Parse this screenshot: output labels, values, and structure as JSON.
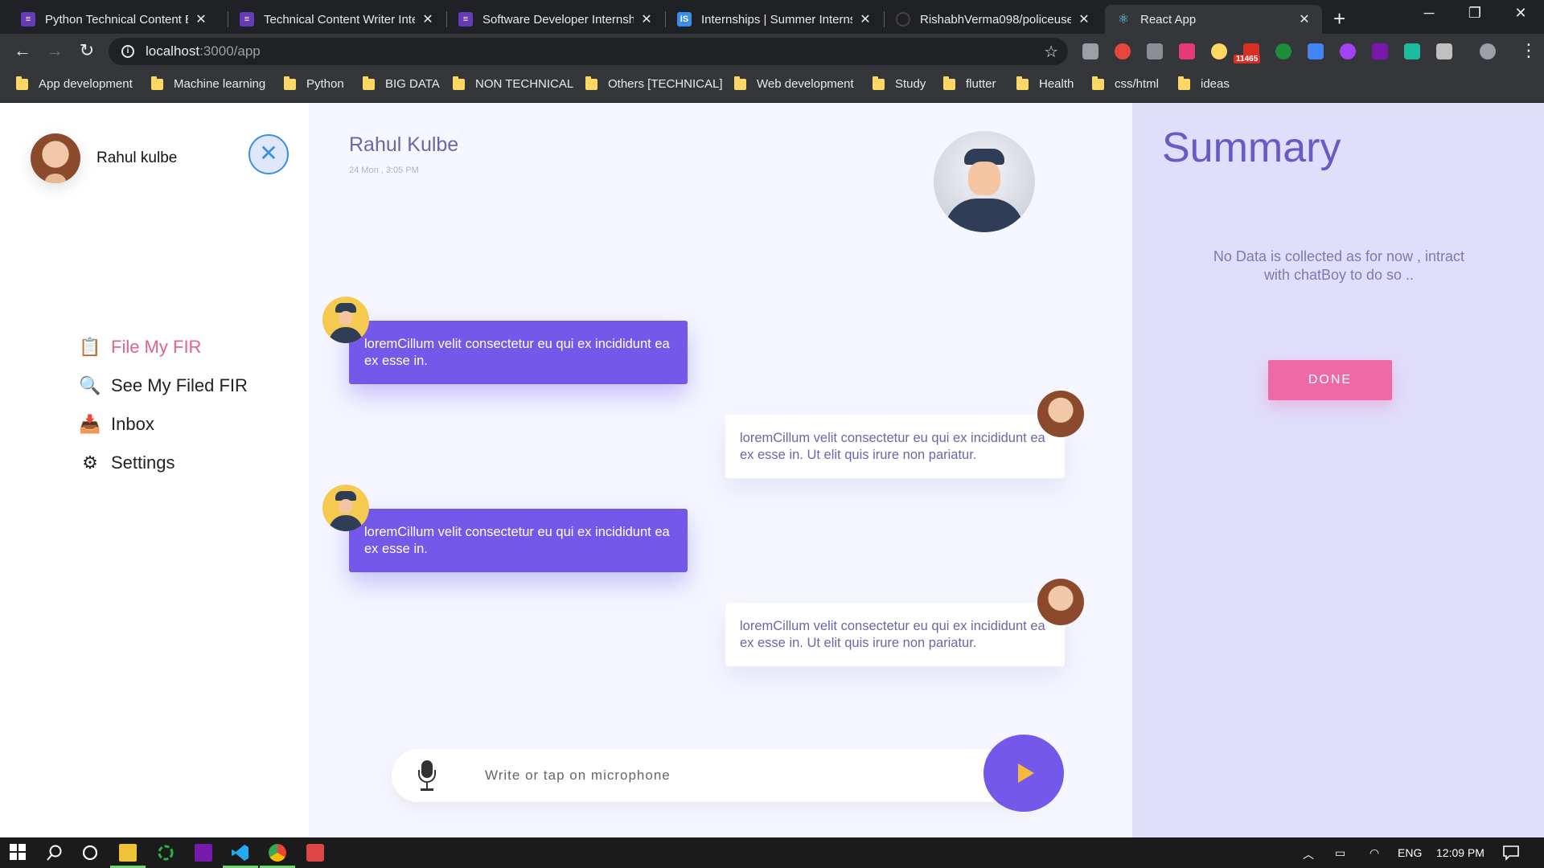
{
  "browser": {
    "tabs": [
      {
        "title": "Python Technical Content Eng",
        "icon": "forms-icon"
      },
      {
        "title": "Technical Content Writer Inte",
        "icon": "forms-icon"
      },
      {
        "title": "Software Developer Internshi",
        "icon": "forms-icon"
      },
      {
        "title": "Internships | Summer Interns",
        "icon": "internshala-icon"
      },
      {
        "title": "RishabhVerma098/policeuse",
        "icon": "github-icon"
      },
      {
        "title": "React App",
        "icon": "react-icon"
      }
    ],
    "close_glyph": "✕",
    "new_tab_glyph": "+",
    "url_host": "localhost",
    "url_path": ":3000/app",
    "extension_badge": "11465",
    "bookmarks": [
      "App development",
      "Machine learning",
      "Python",
      "BIG DATA",
      "NON TECHNICAL",
      "Others [TECHNICAL]",
      "Web development",
      "Study",
      "flutter",
      "Health",
      "css/html",
      "ideas"
    ]
  },
  "sidebar": {
    "user_name": "Rahul kulbe",
    "close_glyph": "✕",
    "menu": [
      {
        "label": "File My FIR",
        "icon": "clipboard-icon",
        "glyph": "📋",
        "active": true
      },
      {
        "label": "See My Filed FIR",
        "icon": "magnifier-icon",
        "glyph": "🔍",
        "active": false
      },
      {
        "label": "Inbox",
        "icon": "inbox-icon",
        "glyph": "📥",
        "active": false
      },
      {
        "label": "Settings",
        "icon": "gear-icon",
        "glyph": "⚙",
        "active": false
      }
    ]
  },
  "chat": {
    "header_name": "Rahul Kulbe",
    "header_time": "24 Mon , 3:05 PM",
    "messages": [
      {
        "from": "bot",
        "text": "loremCillum velit consectetur eu qui ex incididunt ea ex esse in."
      },
      {
        "from": "user",
        "text": "loremCillum velit consectetur eu qui ex incididunt ea ex esse in. Ut elit quis irure non pariatur."
      },
      {
        "from": "bot",
        "text": "loremCillum velit consectetur eu qui ex incididunt ea ex esse in."
      },
      {
        "from": "user",
        "text": "loremCillum velit consectetur eu qui ex incididunt ea ex esse in. Ut elit quis irure non pariatur."
      }
    ],
    "input_placeholder": "Write or tap on microphone"
  },
  "summary": {
    "title": "Summary",
    "message": "No Data is collected as for now , intract with chatBoy to do so ..",
    "done_label": "DONE"
  },
  "taskbar": {
    "language": "ENG",
    "time": "12:09 PM"
  },
  "colors": {
    "primary_purple": "#7358ea",
    "accent_pink": "#ee6aa7",
    "summary_bg": "#e0defb",
    "chat_bg": "#f5f6ff"
  }
}
